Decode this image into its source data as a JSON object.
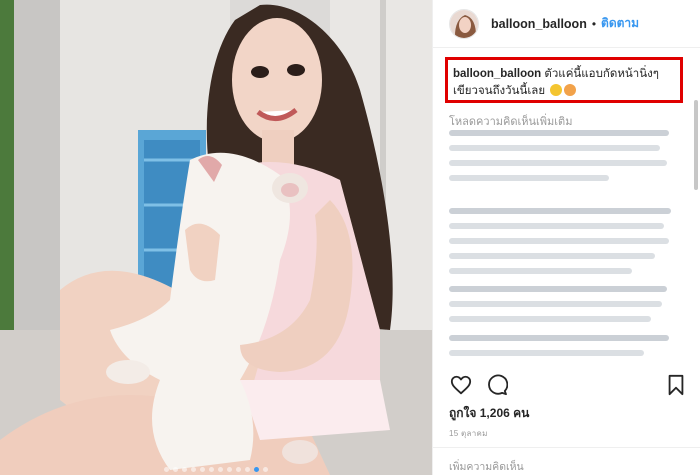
{
  "post": {
    "username": "balloon_balloon",
    "separator": "•",
    "follow_label": "ติดตาม",
    "caption_text": "ตัวแค่นี้แอบกัดหน้านิ่งๆ เขียวจนถึงวันนี้เลย",
    "caption_emojis": [
      "weary-face-emoji",
      "cat-face-emoji"
    ],
    "load_more_label": "โหลดความคิดเห็นเพิ่มเติม",
    "likes": "ถูกใจ 1,206 คน",
    "date": "15 ตุลาคม",
    "add_comment_placeholder": "เพิ่มความคิดเห็น"
  },
  "carousel": {
    "count": 12,
    "active_index": 10
  },
  "icons": {
    "like": "heart-icon",
    "comment": "speech-bubble-icon",
    "save": "bookmark-icon"
  },
  "colors": {
    "highlight_border": "#e00000",
    "follow_link": "#3897f0",
    "muted_text": "#999999"
  }
}
